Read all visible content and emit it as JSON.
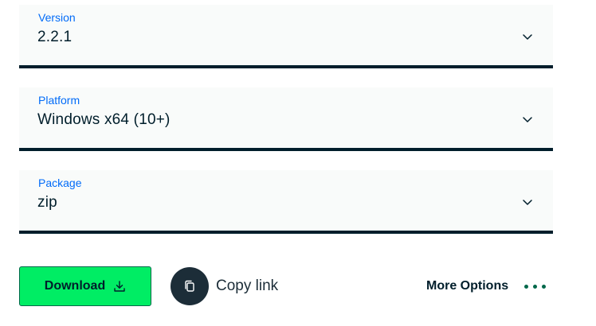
{
  "fields": {
    "version": {
      "label": "Version",
      "value": "2.2.1"
    },
    "platform": {
      "label": "Platform",
      "value": "Windows x64 (10+)"
    },
    "package": {
      "label": "Package",
      "value": "zip"
    }
  },
  "actions": {
    "download_label": "Download",
    "copy_link_label": "Copy link",
    "more_options_label": "More Options"
  },
  "icons": {
    "chevron": "chevron-down-icon",
    "download": "download-icon",
    "copy": "copy-icon",
    "more": "ellipsis-icon"
  },
  "colors": {
    "primary_green": "#00ed64",
    "dark_green": "#00684a",
    "label_blue": "#016bf8",
    "text_dark": "#001e2b",
    "field_bg": "#f9fbfa"
  }
}
